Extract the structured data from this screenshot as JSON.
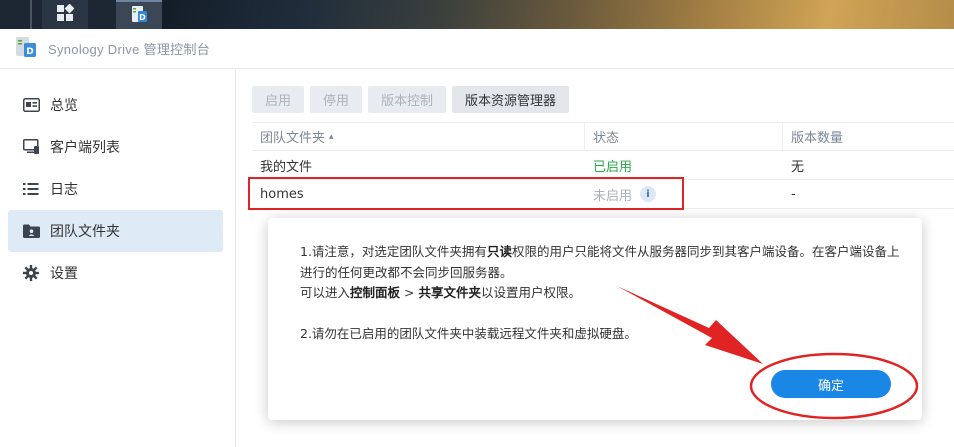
{
  "taskbar": {
    "icons": [
      "grid-icon",
      "synology-drive-icon"
    ]
  },
  "app": {
    "title": "Synology Drive 管理控制台",
    "icon": "synology-drive-logo-icon"
  },
  "sidebar": {
    "items": [
      {
        "label": "总览",
        "icon": "overview-icon",
        "active": false
      },
      {
        "label": "客户端列表",
        "icon": "client-list-icon",
        "active": false
      },
      {
        "label": "日志",
        "icon": "log-icon",
        "active": false
      },
      {
        "label": "团队文件夹",
        "icon": "team-folder-icon",
        "active": true
      },
      {
        "label": "设置",
        "icon": "settings-gear-icon",
        "active": false
      }
    ]
  },
  "toolbar": {
    "enable_label": "启用",
    "disable_label": "停用",
    "version_control_label": "版本控制",
    "version_explorer_label": "版本资源管理器"
  },
  "table": {
    "headers": {
      "folder": "团队文件夹",
      "sort_indicator": "▴",
      "status": "状态",
      "versions": "版本数量"
    },
    "rows": [
      {
        "folder": "我的文件",
        "status": "已启用",
        "versions": "无"
      },
      {
        "folder": "homes",
        "status": "未启用",
        "versions": "-"
      }
    ]
  },
  "dialog": {
    "line1": "1.请注意，对选定团队文件夹拥有",
    "line1_bold": "只读",
    "line1_rest": "权限的用户只能将文件从服务器同步到其客户端设备。在客户端设备上进行的任何更改都不会同步回服务器。",
    "line2_pre": "可以进入",
    "line2_bold1": "控制面板",
    "line2_sep": " > ",
    "line2_bold2": "共享文件夹",
    "line2_post": "以设置用户权限。",
    "line3": "2.请勿在已启用的团队文件夹中装载远程文件夹和虚拟硬盘。",
    "ok_label": "确定"
  },
  "colors": {
    "accent": "#1a86e6",
    "enabled_status": "#2aa84a",
    "annotation_red": "#e02424",
    "active_nav_bg": "#dfeaf7"
  }
}
